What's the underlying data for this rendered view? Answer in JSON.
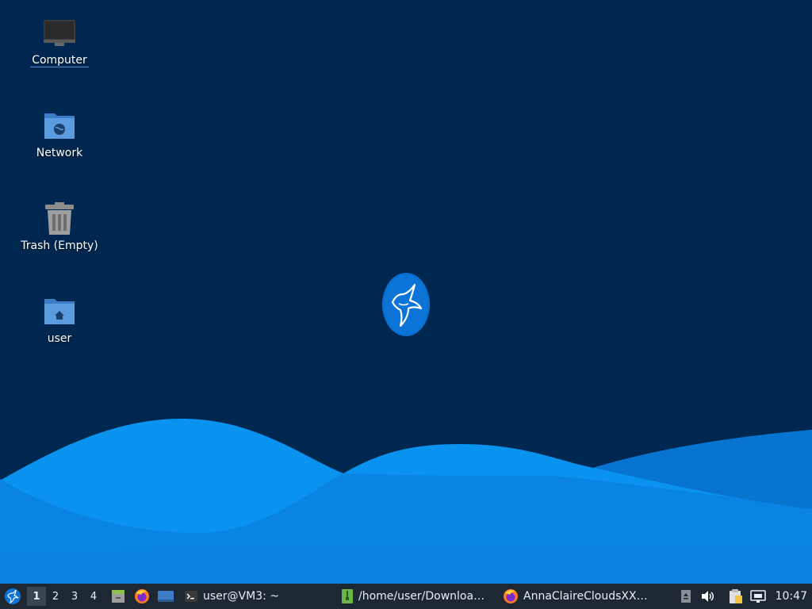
{
  "desktop": {
    "icons": [
      {
        "label": "Computer"
      },
      {
        "label": "Network"
      },
      {
        "label": "Trash (Empty)"
      },
      {
        "label": "user"
      }
    ]
  },
  "taskbar": {
    "workspaces": [
      "1",
      "2",
      "3",
      "4"
    ],
    "active_workspace": "1",
    "tasks": [
      {
        "label": "user@VM3: ~",
        "icon": "terminal-icon"
      },
      {
        "label": "/home/user/Downloa…",
        "icon": "archive-manager-icon"
      },
      {
        "label": "AnnaClaireCloudsXX…",
        "icon": "firefox-icon"
      }
    ],
    "clock": "10:47"
  },
  "colors": {
    "background": "#00274f",
    "wave_light": "#0a8de8",
    "wave_mid": "#0778d6",
    "taskbar": "#1e2833"
  }
}
